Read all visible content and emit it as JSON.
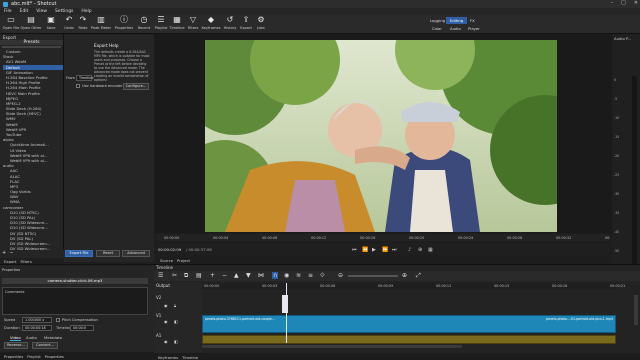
{
  "window": {
    "title": "abc.mlt* - Shotcut",
    "accent": "#2f5fa4"
  },
  "menu": [
    "File",
    "Edit",
    "View",
    "Settings",
    "Help"
  ],
  "toolbar": [
    {
      "label": "Open File",
      "icon": "folder-icon"
    },
    {
      "label": "Open Other",
      "icon": "open-other-icon"
    },
    {
      "label": "Save",
      "icon": "save-icon"
    },
    {
      "label": "Undo",
      "icon": "undo-icon"
    },
    {
      "label": "Redo",
      "icon": "redo-icon"
    },
    {
      "label": "Peak Meter",
      "icon": "peak-meter-icon"
    },
    {
      "label": "Properties",
      "icon": "properties-icon"
    },
    {
      "label": "Recent",
      "icon": "recent-icon"
    },
    {
      "label": "Playlist",
      "icon": "playlist-icon"
    },
    {
      "label": "Timeline",
      "icon": "timeline-icon"
    },
    {
      "label": "Filters",
      "icon": "filters-icon"
    },
    {
      "label": "Keyframes",
      "icon": "keyframes-icon"
    },
    {
      "label": "History",
      "icon": "history-icon"
    },
    {
      "label": "Export",
      "icon": "export-icon"
    },
    {
      "label": "Jobs",
      "icon": "jobs-icon"
    }
  ],
  "layouts": {
    "top": [
      "Logging",
      "Editing",
      "FX"
    ],
    "bottom": [
      "Color",
      "Audio",
      "Player"
    ],
    "active": "Editing"
  },
  "export": {
    "panel_title": "Export",
    "presets_title": "Presets",
    "presets": [
      {
        "text": "Custom",
        "level": 1
      },
      {
        "text": "Stock",
        "level": 0
      },
      {
        "text": "AV1 WebM",
        "level": 1
      },
      {
        "text": "Default",
        "level": 1,
        "selected": true
      },
      {
        "text": "GIF Animation",
        "level": 1
      },
      {
        "text": "H.264 Baseline Profile",
        "level": 1
      },
      {
        "text": "H.264 High Profile",
        "level": 1
      },
      {
        "text": "H.264 Main Profile",
        "level": 1
      },
      {
        "text": "HEVC Main Profile",
        "level": 1
      },
      {
        "text": "MJPEG",
        "level": 1
      },
      {
        "text": "MPEG-2",
        "level": 1
      },
      {
        "text": "Slide Deck (H.264)",
        "level": 1
      },
      {
        "text": "Slide Deck (HEVC)",
        "level": 1
      },
      {
        "text": "WMV",
        "level": 1
      },
      {
        "text": "WebM",
        "level": 1
      },
      {
        "text": "WebM VP9",
        "level": 1
      },
      {
        "text": "YouTube",
        "level": 1
      },
      {
        "text": "alpha",
        "level": 0
      },
      {
        "text": "Quicktime Animati...",
        "level": 2
      },
      {
        "text": "Ut Video",
        "level": 2
      },
      {
        "text": "WebM VP8 with al...",
        "level": 2
      },
      {
        "text": "WebM VP9 with al...",
        "level": 2
      },
      {
        "text": "audio",
        "level": 0
      },
      {
        "text": "AAC",
        "level": 2
      },
      {
        "text": "ALAC",
        "level": 2
      },
      {
        "text": "FLAC",
        "level": 2
      },
      {
        "text": "MP3",
        "level": 2
      },
      {
        "text": "Ogg Vorbis",
        "level": 2
      },
      {
        "text": "WAV",
        "level": 2
      },
      {
        "text": "WMA",
        "level": 2
      },
      {
        "text": "camcorder",
        "level": 0
      },
      {
        "text": "D10 (SD NTSC)",
        "level": 2
      },
      {
        "text": "D10 (SD PAL)",
        "level": 2
      },
      {
        "text": "D10 (SD Widescre...",
        "level": 2
      },
      {
        "text": "D10 (SD Widescre...",
        "level": 2
      },
      {
        "text": "DV (SD NTSC)",
        "level": 2
      },
      {
        "text": "DV (SD PAL)",
        "level": 2
      },
      {
        "text": "DV (SD Widescreen...",
        "level": 2
      },
      {
        "text": "DV (SD Widescreen...",
        "level": 2
      }
    ],
    "help_title": "Export Help",
    "help_text": "The defaults create a H.264/AAC MP4 file, which is suitable for most users and purposes. Choose a Preset at the left before deciding to use the Advanced mode. The Advanced mode does not prevent creating an invalid combination of options!",
    "from_label": "From",
    "from_value": "Timeline",
    "hw_encoder_label": "Use hardware encoder",
    "configure_label": "Configure...",
    "export_file_label": "Export File",
    "reset_label": "Reset",
    "advanced_label": "Advanced",
    "tabs": [
      "Export",
      "Filters"
    ]
  },
  "viewer": {
    "timecode_current": "00:00:02:09",
    "timecode_total": "/ 00:00:37:06",
    "ruler": [
      "00:00:00",
      "00:00:04",
      "00:00:08",
      "00:00:12",
      "00:00:16",
      "00:00:20",
      "00:00:24",
      "00:00:28",
      "00:00:32",
      "00:00:36"
    ],
    "tabs": [
      "Source",
      "Project"
    ]
  },
  "meter": {
    "label": "Audio P...",
    "ticks": [
      "0",
      "-5",
      "-10",
      "-15",
      "-20",
      "-25",
      "-30",
      "-35",
      "-40",
      "-50"
    ]
  },
  "properties": {
    "title": "Properties",
    "filename": "camera-shutter-click-06.mp3",
    "comments_label": "Comments",
    "speed_label": "Speed",
    "speed_value": "1.000000 x",
    "pitch_label": "Pitch Compensation",
    "duration_label": "Duration",
    "duration_value": "00:00:00:18",
    "timeline_label": "Timeline",
    "timeline_value": "00:00:0",
    "tabs": [
      "Video",
      "Audio",
      "Metadata"
    ],
    "reverse_label": "Reverse...",
    "convert_label": "Convert...",
    "bottom_tabs": [
      "Properties",
      "Playlist",
      "Properties"
    ]
  },
  "timeline": {
    "title": "Timeline",
    "output_label": "Output",
    "tracks": [
      "V2",
      "V1",
      "A1"
    ],
    "ruler": [
      "00:00:00",
      "00:00:03",
      "00:00:06",
      "00:00:09",
      "00:00:12",
      "00:00:15",
      "00:00:18",
      "00:00:21"
    ],
    "clip_left": "pexels-photo-3766111-portrait-old-couple...",
    "clip_right": "pexels-photo-...01-portrait-old-pics-1.mp4",
    "tabs": [
      "Keyframes",
      "Timeline"
    ]
  }
}
